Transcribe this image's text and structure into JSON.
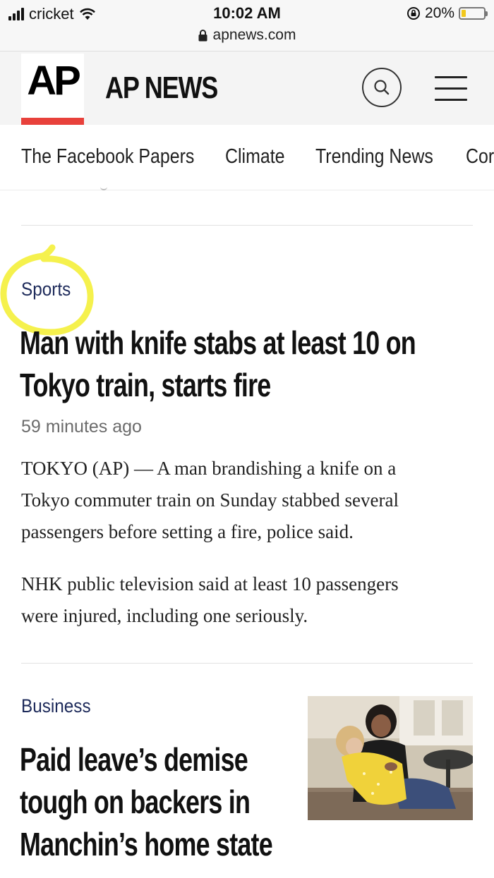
{
  "status_bar": {
    "carrier": "cricket",
    "time": "10:02 AM",
    "url": "apnews.com",
    "battery": "20%",
    "battery_level": 0.2,
    "icons": [
      "signal-bars-icon",
      "wifi-icon",
      "lock-icon",
      "rotation-lock-icon",
      "battery-icon"
    ]
  },
  "header": {
    "logo_text": "AP",
    "brand": "AP NEWS",
    "accent_color": "#e8413b",
    "icons": [
      "search-icon",
      "menu-icon"
    ]
  },
  "nav": {
    "items": [
      "The Facebook Papers",
      "Climate",
      "Trending News",
      "Cor"
    ]
  },
  "articles": [
    {
      "category": "Sports",
      "headline_lines": [
        "Man with knife stabs at least 10 on",
        "Tokyo train, starts fire"
      ],
      "timestamp": "59 minutes ago",
      "paragraphs": [
        [
          "TOKYO (AP) — A man brandishing a knife on a",
          "Tokyo commuter train on Sunday stabbed several",
          "passengers before setting a fire, police said."
        ],
        [
          "NHK public television said at least 10 passengers",
          "were injured, including one seriously."
        ]
      ],
      "highlight_color": "#f4f03a"
    },
    {
      "category": "Business",
      "headline_lines": [
        "Paid leave’s demise",
        "tough on backers in",
        "Manchin’s home state"
      ],
      "has_photo": true
    }
  ],
  "colors": {
    "category_text": "#1d2a5a",
    "header_bg": "#f4f4f4"
  }
}
